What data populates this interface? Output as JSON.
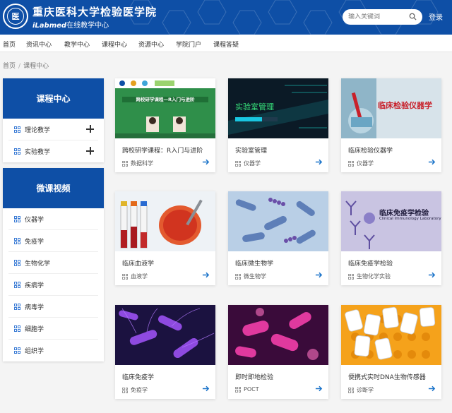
{
  "header": {
    "school_name": "重庆医科大学检验医学院",
    "subtitle_brand": "iLabmed",
    "subtitle_text": "在线教学中心",
    "search_placeholder": "输入关键词",
    "login_label": "登录",
    "accent": "#0e4fa6"
  },
  "nav": {
    "items": [
      "首页",
      "资讯中心",
      "教学中心",
      "课程中心",
      "资源中心",
      "学院门户",
      "课程答疑"
    ]
  },
  "breadcrumb": {
    "home": "首页",
    "separator": "/",
    "current": "课程中心"
  },
  "sidebar": {
    "course_center": {
      "title": "课程中心",
      "items": [
        "理论教学",
        "实验教学"
      ]
    },
    "micro_video": {
      "title": "微课视频",
      "items": [
        "仪器学",
        "免疫学",
        "生物化学",
        "疾病学",
        "病毒学",
        "细胞学",
        "组织学"
      ]
    }
  },
  "cards": [
    {
      "title": "跨校研学课程：R入门与进阶",
      "category": "数据科学",
      "thumb_text": "跨校研学课程—R入门与进阶"
    },
    {
      "title": "实验室管理",
      "category": "仪器学",
      "thumb_text": "实验室管理"
    },
    {
      "title": "临床检验仪器学",
      "category": "仪器学",
      "thumb_text": "临床检验仪器学"
    },
    {
      "title": "临床血液学",
      "category": "血液学",
      "thumb_text": ""
    },
    {
      "title": "临床微生物学",
      "category": "微生物学",
      "thumb_text": ""
    },
    {
      "title": "临床免疫学检验",
      "category": "生物化学实验",
      "thumb_text": "临床免疫学检验",
      "thumb_subtext": "Clinical Immunology Laboratory"
    },
    {
      "title": "临床免疫学",
      "category": "免疫学",
      "thumb_text": ""
    },
    {
      "title": "即时即地检验",
      "category": "POCT",
      "thumb_text": ""
    },
    {
      "title": "便携式实时DNA生物传感器",
      "category": "诊断学",
      "thumb_text": ""
    }
  ]
}
